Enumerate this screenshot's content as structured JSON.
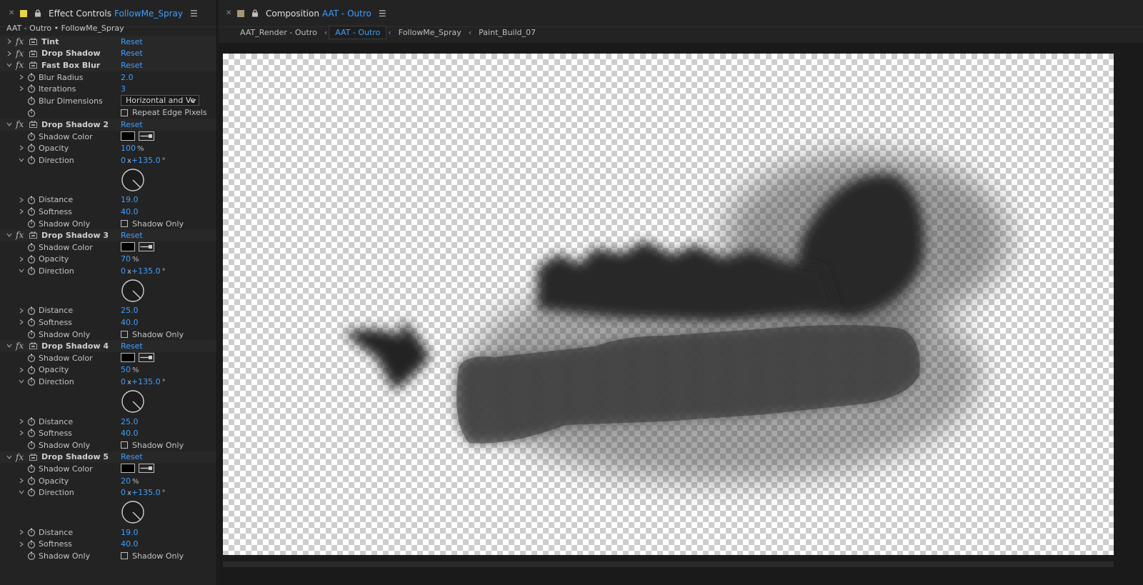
{
  "left_panel": {
    "tab": {
      "title": "Effect Controls",
      "layer": "FollowMe_Spray",
      "swatch_color": "#e8d44a"
    },
    "layer_path": "AAT - Outro • FollowMe_Spray",
    "reset_label": "Reset",
    "tint": {
      "name": "Tint"
    },
    "drop_shadow": {
      "name": "Drop Shadow"
    },
    "fast_box_blur": {
      "name": "Fast Box Blur",
      "blur_radius": {
        "label": "Blur Radius",
        "value": "2.0"
      },
      "iterations": {
        "label": "Iterations",
        "value": "3"
      },
      "blur_dimensions": {
        "label": "Blur Dimensions",
        "value": "Horizontal and Ve"
      },
      "repeat_edge": {
        "label": "Repeat Edge Pixels"
      }
    },
    "shadows": [
      {
        "name": "Drop Shadow 2",
        "opacity": "100",
        "direction_turns": "0",
        "direction_deg": "+135.0",
        "distance": "19.0",
        "softness": "40.0"
      },
      {
        "name": "Drop Shadow 3",
        "opacity": "70",
        "direction_turns": "0",
        "direction_deg": "+135.0",
        "distance": "25.0",
        "softness": "40.0"
      },
      {
        "name": "Drop Shadow 4",
        "opacity": "50",
        "direction_turns": "0",
        "direction_deg": "+135.0",
        "distance": "25.0",
        "softness": "40.0"
      },
      {
        "name": "Drop Shadow 5",
        "opacity": "20",
        "direction_turns": "0",
        "direction_deg": "+135.0",
        "distance": "19.0",
        "softness": "40.0"
      }
    ],
    "labels": {
      "shadow_color": "Shadow Color",
      "opacity": "Opacity",
      "direction": "Direction",
      "distance": "Distance",
      "softness": "Softness",
      "shadow_only": "Shadow Only",
      "percent": "%",
      "turns_sep": "x",
      "degree": "°"
    }
  },
  "right_panel": {
    "tab": {
      "title": "Composition",
      "comp": "AAT - Outro",
      "swatch_color": "#a89478"
    },
    "breadcrumbs": [
      "AAT_Render - Outro",
      "AAT - Outro",
      "FollowMe_Spray",
      "Paint_Build_07"
    ],
    "active_breadcrumb": 1
  },
  "colors": {
    "accent": "#3f9fff",
    "panel_bg": "#232323"
  }
}
